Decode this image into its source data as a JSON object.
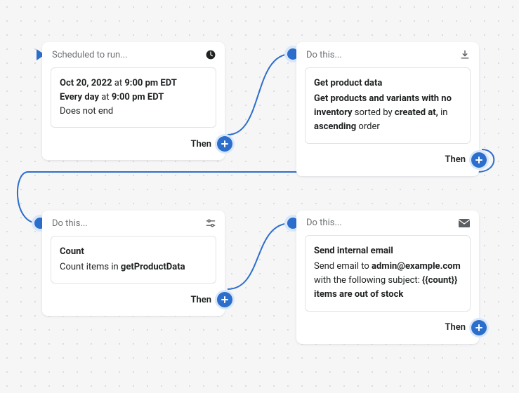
{
  "cards": {
    "trigger": {
      "header_label": "Scheduled to run...",
      "date": "Oct 20, 2022",
      "at1": " at ",
      "time1": "9:00 pm EDT",
      "every": "Every day",
      "at2": " at ",
      "time2": "9:00 pm EDT",
      "end": "Does not end",
      "then": "Then"
    },
    "product": {
      "header_label": "Do this...",
      "title": "Get product data",
      "p1": "Get products and variants with no inventory",
      "p2": " sorted by ",
      "p3": "created at,",
      "p4": " in ",
      "p5": "ascending",
      "p6": " order",
      "then": "Then"
    },
    "count": {
      "header_label": "Do this...",
      "title": "Count",
      "p1": "Count items in ",
      "p2": "getProductData",
      "then": "Then"
    },
    "email": {
      "header_label": "Do this...",
      "title": "Send internal email",
      "p1": "Send email to ",
      "p2": "admin@example.com",
      "p3": " with the following subject: ",
      "p4": "{{count}} items are out of stock",
      "then": "Then"
    }
  }
}
